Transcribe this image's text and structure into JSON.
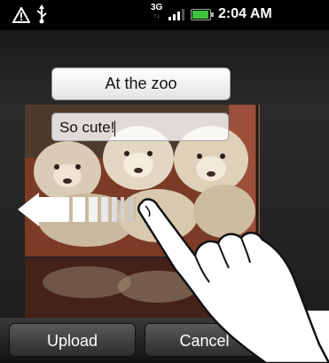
{
  "status_bar": {
    "network_type": "3G",
    "time": "2:04 AM",
    "icons": [
      "warning-icon",
      "usb-icon",
      "network-activity-icon",
      "signal-icon",
      "battery-icon"
    ]
  },
  "title_field": {
    "value": "At the zoo"
  },
  "caption_field": {
    "value": "So cute!"
  },
  "photo": {
    "subject": "lion-cubs-photo"
  },
  "gesture": {
    "icons": [
      "swipe-left-arrow-icon",
      "hand-pointer-icon"
    ]
  },
  "buttons": {
    "upload": "Upload",
    "cancel": "Cancel"
  },
  "colors": {
    "battery": "#3ec23e",
    "status_bar": "#000000",
    "button": "#3a3a3a"
  }
}
